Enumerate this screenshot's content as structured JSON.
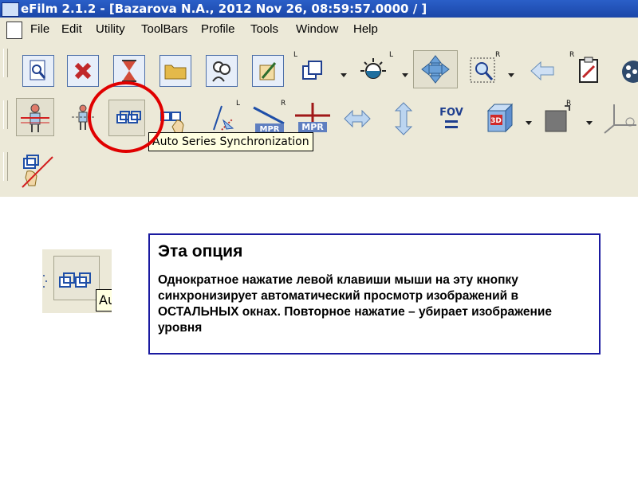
{
  "window": {
    "title": "eFilm 2.1.2 - [Bazarova N.A., 2012 Nov 26, 08:59:57.0000  /  ]"
  },
  "menu": [
    "File",
    "Edit",
    "Utility",
    "ToolBars",
    "Profile",
    "Tools",
    "Window",
    "Help"
  ],
  "toolbar": {
    "tooltip": "Auto Series Synchronization",
    "superscripts": [
      "L",
      "L",
      "R",
      "R",
      "L",
      "R",
      "R"
    ],
    "fov_label": "FOV",
    "mpr_label": "MPR",
    "three_d_label": "3D"
  },
  "zoom": {
    "tooltip_fragment": "Au"
  },
  "callout": {
    "title": "Эта опция",
    "body": "Однократное нажатие левой клавиши мыши на эту кнопку  синхронизирует автоматический просмотр изображений в ОСТАЛЬНЫХ окнах. Повторное нажатие – убирает изображение уровня"
  },
  "colors": {
    "title_bar": "#1b46a8",
    "highlight_circle": "#e00000",
    "callout_border": "#1a1aa0",
    "toolbar_bg": "#ece9d8"
  }
}
